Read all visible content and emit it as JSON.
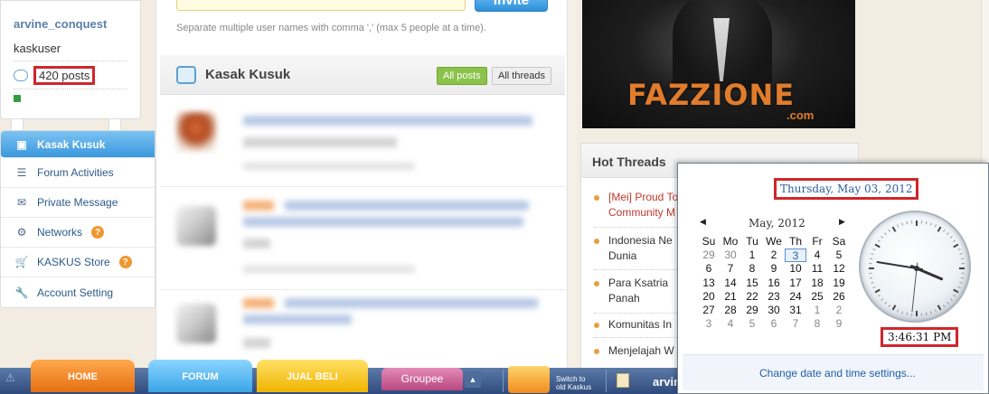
{
  "user": {
    "username": "arvine_conquest",
    "group": "kaskuser",
    "posts": "420 posts"
  },
  "nav": {
    "items": [
      {
        "label": "Kasak Kusuk",
        "icon": "chat-icon"
      },
      {
        "label": "Forum Activities",
        "icon": "list-icon"
      },
      {
        "label": "Private Message",
        "icon": "envelope-icon"
      },
      {
        "label": "Networks",
        "icon": "network-icon"
      },
      {
        "label": "KASKUS Store",
        "icon": "cart-icon"
      },
      {
        "label": "Account Setting",
        "icon": "wrench-icon"
      }
    ],
    "help_badge": "?"
  },
  "invite": {
    "button_label": "Invite",
    "hint": "Separate multiple user names with comma ',' (max 5 people at a time)."
  },
  "feed": {
    "title": "Kasak Kusuk",
    "tab_all_posts": "All posts",
    "tab_all_threads": "All threads"
  },
  "banner": {
    "brand": "FAZZIONE",
    "domain": ".com"
  },
  "hot_threads": {
    "title": "Hot Threads",
    "items": [
      {
        "line1": "[Mei] Proud To",
        "line2": "Community M",
        "highlight": true
      },
      {
        "line1": "Indonesia Ne",
        "line2": "Dunia",
        "highlight": false
      },
      {
        "line1": "Para Ksatria",
        "line2": "Panah",
        "highlight": false
      },
      {
        "line1": "Komunitas In",
        "line2": "",
        "highlight": false
      },
      {
        "line1": "Menjelajah W",
        "line2": "",
        "highlight": false
      }
    ]
  },
  "taskbar": {
    "home": "HOME",
    "forum": "FORUM",
    "jual_beli": "JUAL BELI",
    "groupee": "Groupee",
    "up_arrow": "▲",
    "switch_line1": "Switch to",
    "switch_line2": "old Kaskus",
    "user": "arvin"
  },
  "clock_popup": {
    "date_long": "Thursday, May 03, 2012",
    "month_label": "May, 2012",
    "nav_prev": "◀",
    "nav_next": "▶",
    "weekdays": [
      "Su",
      "Mo",
      "Tu",
      "We",
      "Th",
      "Fr",
      "Sa"
    ],
    "weeks": [
      [
        "29",
        "30",
        "1",
        "2",
        "3",
        "4",
        "5"
      ],
      [
        "6",
        "7",
        "8",
        "9",
        "10",
        "11",
        "12"
      ],
      [
        "13",
        "14",
        "15",
        "16",
        "17",
        "18",
        "19"
      ],
      [
        "20",
        "21",
        "22",
        "23",
        "24",
        "25",
        "26"
      ],
      [
        "27",
        "28",
        "29",
        "30",
        "31",
        "1",
        "2"
      ],
      [
        "3",
        "4",
        "5",
        "6",
        "7",
        "8",
        "9"
      ]
    ],
    "selected_day": "3",
    "time": "3:46:31 PM",
    "clock_hours": 3,
    "clock_minutes": 46,
    "clock_seconds": 31,
    "change_link": "Change date and time settings..."
  },
  "colors": {
    "highlight_box": "#d0262b",
    "link_blue": "#2c5a8a",
    "brand_orange": "#e07c2b",
    "hot_red": "#c0392b"
  }
}
